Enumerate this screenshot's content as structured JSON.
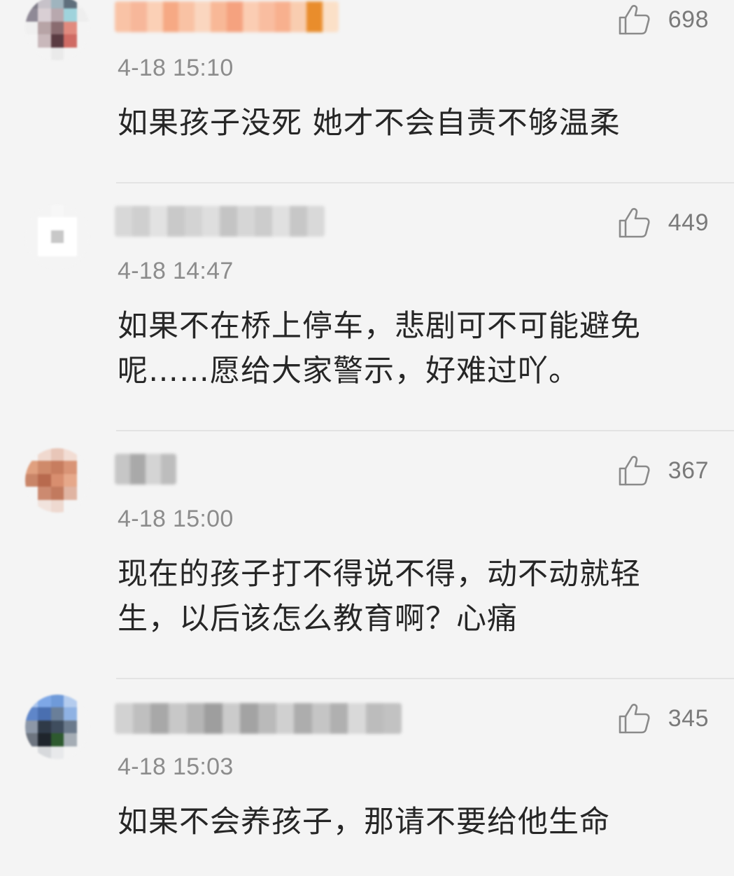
{
  "comments": [
    {
      "likes": "698",
      "timestamp": "4-18 15:10",
      "text": "如果孩子没死 她才不会自责不够温柔",
      "avatar_colors": [
        "#7d7a86",
        "#c7c2c9",
        "#9fb4be",
        "#5f6f7c",
        "#f2f2f2",
        "#8f8996",
        "#d9cfd4",
        "#b8a8ae",
        "#9fd3dc",
        "#eeeeee",
        "#f0f0f0",
        "#b7a4a6",
        "#8a6c70",
        "#e18a7e",
        "#f4f4f4",
        "#f4f4f4",
        "#c9b8bb",
        "#5a3b42",
        "#cf6b64",
        "#f4f4f4",
        "#f4f4f4",
        "#f4f4f4",
        "#eaeaea",
        "#f4f4f4",
        "#f4f4f4"
      ],
      "name_colors": [
        "#f9c3a6",
        "#f7b79a",
        "#fbd0b6",
        "#f6a984",
        "#f9c2a4",
        "#fad6bf",
        "#f8b897",
        "#f5a27f",
        "#fbcdb3",
        "#f9bda0",
        "#f8b08e",
        "#f9cdb0",
        "#e98d2c",
        "#fbe0c7"
      ]
    },
    {
      "likes": "449",
      "timestamp": "4-18 14:47",
      "text": "如果不在桥上停车，悲剧可不可能避免呢……愿给大家警示，好难过吖。",
      "avatar_colors": [
        "#f4f4f4",
        "#f4f4f4",
        "#f7f7f7",
        "#f4f4f4",
        "#f4f4f4",
        "#f4f4f4",
        "#ffffff",
        "#ffffff",
        "#ffffff",
        "#f4f4f4",
        "#f4f4f4",
        "#ffffff",
        "#c8c8c8",
        "#ffffff",
        "#f4f4f4",
        "#f4f4f4",
        "#ffffff",
        "#ffffff",
        "#ffffff",
        "#f4f4f4",
        "#f4f4f4",
        "#f4f4f4",
        "#f4f4f4",
        "#f4f4f4",
        "#f4f4f4"
      ],
      "name_colors": [
        "#d8d8d8",
        "#cfcfcf",
        "#e2e2e2",
        "#c9c9c9",
        "#d3d3d3",
        "#dedede",
        "#c4c4c4",
        "#d6d6d6",
        "#cccccc",
        "#e0e0e0",
        "#c7c7c7",
        "#d9d9d9"
      ]
    },
    {
      "likes": "367",
      "timestamp": "4-18 15:00",
      "text": "现在的孩子打不得说不得，动不动就轻生，以后该怎么教育啊？心痛",
      "avatar_colors": [
        "#f4f4f4",
        "#f0d9cf",
        "#e8c6b8",
        "#f2ddd4",
        "#f4f4f4",
        "#e0a07f",
        "#cf8a6a",
        "#c77d5f",
        "#d99476",
        "#f4f4f4",
        "#c98568",
        "#b86a4e",
        "#d88e6f",
        "#e6a88a",
        "#f4f4f4",
        "#f4f4f4",
        "#cc8a70",
        "#c27a5e",
        "#e0b4a2",
        "#f4f4f4",
        "#f4f4f4",
        "#f1e3dd",
        "#eed9d0",
        "#f4f4f4",
        "#f4f4f4"
      ],
      "name_colors": [
        "#c6c6c6",
        "#a9a9a9",
        "#d4d4d4",
        "#bdbdbd"
      ]
    },
    {
      "likes": "345",
      "timestamp": "4-18 15:03",
      "text": "如果不会养孩子，那请不要给他生命",
      "avatar_colors": [
        "#a9c4ec",
        "#7ea7e6",
        "#6f9ad9",
        "#b4ccee",
        "#f4f4f4",
        "#5f86c9",
        "#4a6fb0",
        "#6a7f99",
        "#8fb2e3",
        "#f4f4f4",
        "#8d98a8",
        "#2f3a48",
        "#3f4d5e",
        "#6b7a8c",
        "#f4f4f4",
        "#6e7580",
        "#1f252c",
        "#2e5a2f",
        "#a5adb5",
        "#f4f4f4",
        "#f4f4f4",
        "#d7d9dc",
        "#e8e9eb",
        "#f4f4f4",
        "#f4f4f4"
      ],
      "name_colors": [
        "#d2d2d2",
        "#bfbfbf",
        "#a8a8a8",
        "#c8c8c8",
        "#b5b5b5",
        "#9e9e9e",
        "#cbcbcb",
        "#a3a3a3",
        "#bababa",
        "#d0d0d0",
        "#adadad",
        "#c5c5c5",
        "#b0b0b0",
        "#d9d9d9",
        "#bcbcbc",
        "#c2c2c2"
      ]
    }
  ]
}
